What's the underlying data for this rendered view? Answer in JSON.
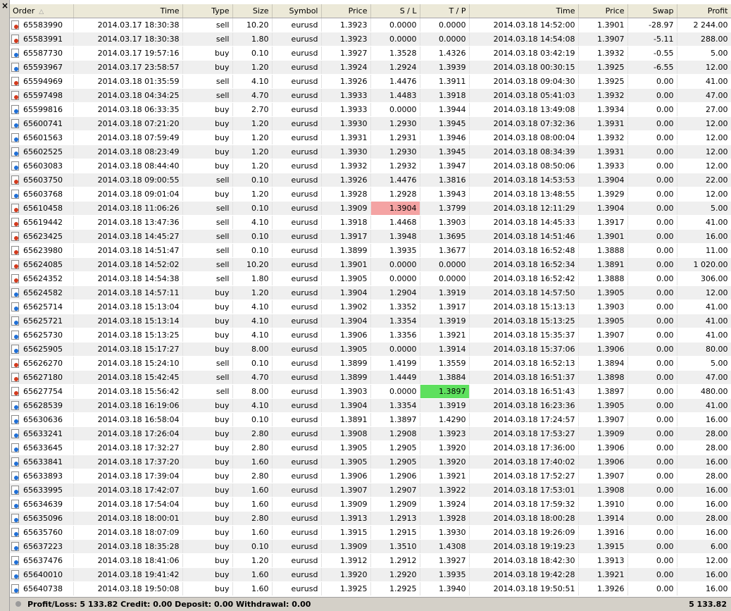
{
  "close_glyph": "×",
  "columns": {
    "order": "Order",
    "open_time": "Time",
    "type": "Type",
    "size": "Size",
    "symbol": "Symbol",
    "open_price": "Price",
    "sl": "S / L",
    "tp": "T / P",
    "close_time": "Time",
    "close_price": "Price",
    "swap": "Swap",
    "profit": "Profit"
  },
  "sort_indicator": "△",
  "colors": {
    "sell_icon": "#d23a1e",
    "buy_icon": "#1f6fd6",
    "sl_highlight": "#f4a3a3",
    "tp_highlight": "#5ee05e"
  },
  "rows": [
    {
      "order": "65583990",
      "open_time": "2014.03.17 18:30:38",
      "type": "sell",
      "size": "10.20",
      "symbol": "eurusd",
      "open_price": "1.3923",
      "sl": "0.0000",
      "tp": "0.0000",
      "close_time": "2014.03.18 14:52:00",
      "close_price": "1.3901",
      "swap": "-28.97",
      "profit": "2 244.00"
    },
    {
      "order": "65583991",
      "open_time": "2014.03.17 18:30:38",
      "type": "sell",
      "size": "1.80",
      "symbol": "eurusd",
      "open_price": "1.3923",
      "sl": "0.0000",
      "tp": "0.0000",
      "close_time": "2014.03.18 14:54:08",
      "close_price": "1.3907",
      "swap": "-5.11",
      "profit": "288.00"
    },
    {
      "order": "65587730",
      "open_time": "2014.03.17 19:57:16",
      "type": "buy",
      "size": "0.10",
      "symbol": "eurusd",
      "open_price": "1.3927",
      "sl": "1.3528",
      "tp": "1.4326",
      "close_time": "2014.03.18 03:42:19",
      "close_price": "1.3932",
      "swap": "-0.55",
      "profit": "5.00"
    },
    {
      "order": "65593967",
      "open_time": "2014.03.17 23:58:57",
      "type": "buy",
      "size": "1.20",
      "symbol": "eurusd",
      "open_price": "1.3924",
      "sl": "1.2924",
      "tp": "1.3939",
      "close_time": "2014.03.18 00:30:15",
      "close_price": "1.3925",
      "swap": "-6.55",
      "profit": "12.00"
    },
    {
      "order": "65594969",
      "open_time": "2014.03.18 01:35:59",
      "type": "sell",
      "size": "4.10",
      "symbol": "eurusd",
      "open_price": "1.3926",
      "sl": "1.4476",
      "tp": "1.3911",
      "close_time": "2014.03.18 09:04:30",
      "close_price": "1.3925",
      "swap": "0.00",
      "profit": "41.00"
    },
    {
      "order": "65597498",
      "open_time": "2014.03.18 04:34:25",
      "type": "sell",
      "size": "4.70",
      "symbol": "eurusd",
      "open_price": "1.3933",
      "sl": "1.4483",
      "tp": "1.3918",
      "close_time": "2014.03.18 05:41:03",
      "close_price": "1.3932",
      "swap": "0.00",
      "profit": "47.00"
    },
    {
      "order": "65599816",
      "open_time": "2014.03.18 06:33:35",
      "type": "buy",
      "size": "2.70",
      "symbol": "eurusd",
      "open_price": "1.3933",
      "sl": "0.0000",
      "tp": "1.3944",
      "close_time": "2014.03.18 13:49:08",
      "close_price": "1.3934",
      "swap": "0.00",
      "profit": "27.00"
    },
    {
      "order": "65600741",
      "open_time": "2014.03.18 07:21:20",
      "type": "buy",
      "size": "1.20",
      "symbol": "eurusd",
      "open_price": "1.3930",
      "sl": "1.2930",
      "tp": "1.3945",
      "close_time": "2014.03.18 07:32:36",
      "close_price": "1.3931",
      "swap": "0.00",
      "profit": "12.00"
    },
    {
      "order": "65601563",
      "open_time": "2014.03.18 07:59:49",
      "type": "buy",
      "size": "1.20",
      "symbol": "eurusd",
      "open_price": "1.3931",
      "sl": "1.2931",
      "tp": "1.3946",
      "close_time": "2014.03.18 08:00:04",
      "close_price": "1.3932",
      "swap": "0.00",
      "profit": "12.00"
    },
    {
      "order": "65602525",
      "open_time": "2014.03.18 08:23:49",
      "type": "buy",
      "size": "1.20",
      "symbol": "eurusd",
      "open_price": "1.3930",
      "sl": "1.2930",
      "tp": "1.3945",
      "close_time": "2014.03.18 08:34:39",
      "close_price": "1.3931",
      "swap": "0.00",
      "profit": "12.00"
    },
    {
      "order": "65603083",
      "open_time": "2014.03.18 08:44:40",
      "type": "buy",
      "size": "1.20",
      "symbol": "eurusd",
      "open_price": "1.3932",
      "sl": "1.2932",
      "tp": "1.3947",
      "close_time": "2014.03.18 08:50:06",
      "close_price": "1.3933",
      "swap": "0.00",
      "profit": "12.00"
    },
    {
      "order": "65603750",
      "open_time": "2014.03.18 09:00:55",
      "type": "sell",
      "size": "0.10",
      "symbol": "eurusd",
      "open_price": "1.3926",
      "sl": "1.4476",
      "tp": "1.3816",
      "close_time": "2014.03.18 14:53:53",
      "close_price": "1.3904",
      "swap": "0.00",
      "profit": "22.00"
    },
    {
      "order": "65603768",
      "open_time": "2014.03.18 09:01:04",
      "type": "buy",
      "size": "1.20",
      "symbol": "eurusd",
      "open_price": "1.3928",
      "sl": "1.2928",
      "tp": "1.3943",
      "close_time": "2014.03.18 13:48:55",
      "close_price": "1.3929",
      "swap": "0.00",
      "profit": "12.00"
    },
    {
      "order": "65610458",
      "open_time": "2014.03.18 11:06:26",
      "type": "sell",
      "size": "0.10",
      "symbol": "eurusd",
      "open_price": "1.3909",
      "sl": "1.3904",
      "tp": "1.3799",
      "close_time": "2014.03.18 12:11:29",
      "close_price": "1.3904",
      "swap": "0.00",
      "profit": "5.00",
      "sl_hit": true
    },
    {
      "order": "65619442",
      "open_time": "2014.03.18 13:47:36",
      "type": "sell",
      "size": "4.10",
      "symbol": "eurusd",
      "open_price": "1.3918",
      "sl": "1.4468",
      "tp": "1.3903",
      "close_time": "2014.03.18 14:45:33",
      "close_price": "1.3917",
      "swap": "0.00",
      "profit": "41.00"
    },
    {
      "order": "65623425",
      "open_time": "2014.03.18 14:45:27",
      "type": "sell",
      "size": "0.10",
      "symbol": "eurusd",
      "open_price": "1.3917",
      "sl": "1.3948",
      "tp": "1.3695",
      "close_time": "2014.03.18 14:51:46",
      "close_price": "1.3901",
      "swap": "0.00",
      "profit": "16.00"
    },
    {
      "order": "65623980",
      "open_time": "2014.03.18 14:51:47",
      "type": "sell",
      "size": "0.10",
      "symbol": "eurusd",
      "open_price": "1.3899",
      "sl": "1.3935",
      "tp": "1.3677",
      "close_time": "2014.03.18 16:52:48",
      "close_price": "1.3888",
      "swap": "0.00",
      "profit": "11.00"
    },
    {
      "order": "65624085",
      "open_time": "2014.03.18 14:52:02",
      "type": "sell",
      "size": "10.20",
      "symbol": "eurusd",
      "open_price": "1.3901",
      "sl": "0.0000",
      "tp": "0.0000",
      "close_time": "2014.03.18 16:52:34",
      "close_price": "1.3891",
      "swap": "0.00",
      "profit": "1 020.00"
    },
    {
      "order": "65624352",
      "open_time": "2014.03.18 14:54:38",
      "type": "sell",
      "size": "1.80",
      "symbol": "eurusd",
      "open_price": "1.3905",
      "sl": "0.0000",
      "tp": "0.0000",
      "close_time": "2014.03.18 16:52:42",
      "close_price": "1.3888",
      "swap": "0.00",
      "profit": "306.00"
    },
    {
      "order": "65624582",
      "open_time": "2014.03.18 14:57:11",
      "type": "buy",
      "size": "1.20",
      "symbol": "eurusd",
      "open_price": "1.3904",
      "sl": "1.2904",
      "tp": "1.3919",
      "close_time": "2014.03.18 14:57:50",
      "close_price": "1.3905",
      "swap": "0.00",
      "profit": "12.00"
    },
    {
      "order": "65625714",
      "open_time": "2014.03.18 15:13:04",
      "type": "buy",
      "size": "4.10",
      "symbol": "eurusd",
      "open_price": "1.3902",
      "sl": "1.3352",
      "tp": "1.3917",
      "close_time": "2014.03.18 15:13:13",
      "close_price": "1.3903",
      "swap": "0.00",
      "profit": "41.00"
    },
    {
      "order": "65625721",
      "open_time": "2014.03.18 15:13:14",
      "type": "buy",
      "size": "4.10",
      "symbol": "eurusd",
      "open_price": "1.3904",
      "sl": "1.3354",
      "tp": "1.3919",
      "close_time": "2014.03.18 15:13:25",
      "close_price": "1.3905",
      "swap": "0.00",
      "profit": "41.00"
    },
    {
      "order": "65625730",
      "open_time": "2014.03.18 15:13:25",
      "type": "buy",
      "size": "4.10",
      "symbol": "eurusd",
      "open_price": "1.3906",
      "sl": "1.3356",
      "tp": "1.3921",
      "close_time": "2014.03.18 15:35:37",
      "close_price": "1.3907",
      "swap": "0.00",
      "profit": "41.00"
    },
    {
      "order": "65625905",
      "open_time": "2014.03.18 15:17:27",
      "type": "buy",
      "size": "8.00",
      "symbol": "eurusd",
      "open_price": "1.3905",
      "sl": "0.0000",
      "tp": "1.3914",
      "close_time": "2014.03.18 15:37:06",
      "close_price": "1.3906",
      "swap": "0.00",
      "profit": "80.00"
    },
    {
      "order": "65626270",
      "open_time": "2014.03.18 15:24:10",
      "type": "sell",
      "size": "0.10",
      "symbol": "eurusd",
      "open_price": "1.3899",
      "sl": "1.4199",
      "tp": "1.3559",
      "close_time": "2014.03.18 16:52:13",
      "close_price": "1.3894",
      "swap": "0.00",
      "profit": "5.00"
    },
    {
      "order": "65627180",
      "open_time": "2014.03.18 15:42:45",
      "type": "sell",
      "size": "4.70",
      "symbol": "eurusd",
      "open_price": "1.3899",
      "sl": "1.4449",
      "tp": "1.3884",
      "close_time": "2014.03.18 16:51:37",
      "close_price": "1.3898",
      "swap": "0.00",
      "profit": "47.00"
    },
    {
      "order": "65627754",
      "open_time": "2014.03.18 15:56:42",
      "type": "sell",
      "size": "8.00",
      "symbol": "eurusd",
      "open_price": "1.3903",
      "sl": "0.0000",
      "tp": "1.3897",
      "close_time": "2014.03.18 16:51:43",
      "close_price": "1.3897",
      "swap": "0.00",
      "profit": "480.00",
      "tp_hit": true
    },
    {
      "order": "65628539",
      "open_time": "2014.03.18 16:19:06",
      "type": "buy",
      "size": "4.10",
      "symbol": "eurusd",
      "open_price": "1.3904",
      "sl": "1.3354",
      "tp": "1.3919",
      "close_time": "2014.03.18 16:23:36",
      "close_price": "1.3905",
      "swap": "0.00",
      "profit": "41.00"
    },
    {
      "order": "65630636",
      "open_time": "2014.03.18 16:58:04",
      "type": "buy",
      "size": "0.10",
      "symbol": "eurusd",
      "open_price": "1.3891",
      "sl": "1.3897",
      "tp": "1.4290",
      "close_time": "2014.03.18 17:24:57",
      "close_price": "1.3907",
      "swap": "0.00",
      "profit": "16.00"
    },
    {
      "order": "65633241",
      "open_time": "2014.03.18 17:26:04",
      "type": "buy",
      "size": "2.80",
      "symbol": "eurusd",
      "open_price": "1.3908",
      "sl": "1.2908",
      "tp": "1.3923",
      "close_time": "2014.03.18 17:53:27",
      "close_price": "1.3909",
      "swap": "0.00",
      "profit": "28.00"
    },
    {
      "order": "65633645",
      "open_time": "2014.03.18 17:32:27",
      "type": "buy",
      "size": "2.80",
      "symbol": "eurusd",
      "open_price": "1.3905",
      "sl": "1.2905",
      "tp": "1.3920",
      "close_time": "2014.03.18 17:36:00",
      "close_price": "1.3906",
      "swap": "0.00",
      "profit": "28.00"
    },
    {
      "order": "65633841",
      "open_time": "2014.03.18 17:37:20",
      "type": "buy",
      "size": "1.60",
      "symbol": "eurusd",
      "open_price": "1.3905",
      "sl": "1.2905",
      "tp": "1.3920",
      "close_time": "2014.03.18 17:40:02",
      "close_price": "1.3906",
      "swap": "0.00",
      "profit": "16.00"
    },
    {
      "order": "65633893",
      "open_time": "2014.03.18 17:39:04",
      "type": "buy",
      "size": "2.80",
      "symbol": "eurusd",
      "open_price": "1.3906",
      "sl": "1.2906",
      "tp": "1.3921",
      "close_time": "2014.03.18 17:52:27",
      "close_price": "1.3907",
      "swap": "0.00",
      "profit": "28.00"
    },
    {
      "order": "65633995",
      "open_time": "2014.03.18 17:42:07",
      "type": "buy",
      "size": "1.60",
      "symbol": "eurusd",
      "open_price": "1.3907",
      "sl": "1.2907",
      "tp": "1.3922",
      "close_time": "2014.03.18 17:53:01",
      "close_price": "1.3908",
      "swap": "0.00",
      "profit": "16.00"
    },
    {
      "order": "65634639",
      "open_time": "2014.03.18 17:54:04",
      "type": "buy",
      "size": "1.60",
      "symbol": "eurusd",
      "open_price": "1.3909",
      "sl": "1.2909",
      "tp": "1.3924",
      "close_time": "2014.03.18 17:59:32",
      "close_price": "1.3910",
      "swap": "0.00",
      "profit": "16.00"
    },
    {
      "order": "65635096",
      "open_time": "2014.03.18 18:00:01",
      "type": "buy",
      "size": "2.80",
      "symbol": "eurusd",
      "open_price": "1.3913",
      "sl": "1.2913",
      "tp": "1.3928",
      "close_time": "2014.03.18 18:00:28",
      "close_price": "1.3914",
      "swap": "0.00",
      "profit": "28.00"
    },
    {
      "order": "65635760",
      "open_time": "2014.03.18 18:07:09",
      "type": "buy",
      "size": "1.60",
      "symbol": "eurusd",
      "open_price": "1.3915",
      "sl": "1.2915",
      "tp": "1.3930",
      "close_time": "2014.03.18 19:26:09",
      "close_price": "1.3916",
      "swap": "0.00",
      "profit": "16.00"
    },
    {
      "order": "65637223",
      "open_time": "2014.03.18 18:35:28",
      "type": "buy",
      "size": "0.10",
      "symbol": "eurusd",
      "open_price": "1.3909",
      "sl": "1.3510",
      "tp": "1.4308",
      "close_time": "2014.03.18 19:19:23",
      "close_price": "1.3915",
      "swap": "0.00",
      "profit": "6.00"
    },
    {
      "order": "65637476",
      "open_time": "2014.03.18 18:41:06",
      "type": "buy",
      "size": "1.20",
      "symbol": "eurusd",
      "open_price": "1.3912",
      "sl": "1.2912",
      "tp": "1.3927",
      "close_time": "2014.03.18 18:42:30",
      "close_price": "1.3913",
      "swap": "0.00",
      "profit": "12.00"
    },
    {
      "order": "65640010",
      "open_time": "2014.03.18 19:41:42",
      "type": "buy",
      "size": "1.60",
      "symbol": "eurusd",
      "open_price": "1.3920",
      "sl": "1.2920",
      "tp": "1.3935",
      "close_time": "2014.03.18 19:42:28",
      "close_price": "1.3921",
      "swap": "0.00",
      "profit": "16.00"
    },
    {
      "order": "65640738",
      "open_time": "2014.03.18 19:50:08",
      "type": "buy",
      "size": "1.60",
      "symbol": "eurusd",
      "open_price": "1.3925",
      "sl": "1.2925",
      "tp": "1.3940",
      "close_time": "2014.03.18 19:50:51",
      "close_price": "1.3926",
      "swap": "0.00",
      "profit": "16.00"
    }
  ],
  "status": {
    "summary": "Profit/Loss: 5 133.82  Credit: 0.00  Deposit: 0.00  Withdrawal: 0.00",
    "total": "5 133.82"
  }
}
